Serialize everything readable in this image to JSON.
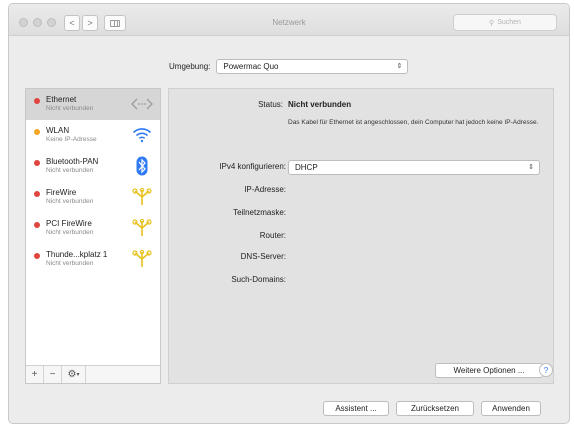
{
  "window": {
    "title": "Netzwerk",
    "search_placeholder": "Suchen",
    "nav_back": "<",
    "nav_forward": ">",
    "grid_icon": "show-all-grid-icon"
  },
  "location": {
    "label": "Umgebung:",
    "value": "Powermac Quo"
  },
  "services": [
    {
      "name": "Ethernet",
      "status": "Nicht verbunden",
      "dot_color": "#e0443e",
      "icon": "ethernet-icon"
    },
    {
      "name": "WLAN",
      "status": "Keine IP-Adresse",
      "dot_color": "#f5a623",
      "icon": "wifi-icon"
    },
    {
      "name": "Bluetooth-PAN",
      "status": "Nicht verbunden",
      "dot_color": "#e0443e",
      "icon": "bluetooth-icon"
    },
    {
      "name": "FireWire",
      "status": "Nicht verbunden",
      "dot_color": "#e0443e",
      "icon": "firewire-icon"
    },
    {
      "name": "PCI FireWire",
      "status": "Nicht verbunden",
      "dot_color": "#e0443e",
      "icon": "firewire-icon"
    },
    {
      "name": "Thunde...kplatz 1",
      "status": "Nicht verbunden",
      "dot_color": "#e0443e",
      "icon": "thunderbolt-bridge-icon"
    }
  ],
  "sidebar_controls": {
    "add": "+",
    "remove": "−"
  },
  "detail": {
    "status_label": "Status:",
    "status_value": "Nicht verbunden",
    "status_description": "Das Kabel für Ethernet ist angeschlossen, dein Computer hat jedoch keine IP-Adresse.",
    "ipv4_label": "IPv4 konfigurieren:",
    "ipv4_value": "DHCP",
    "ip_label": "IP-Adresse:",
    "subnet_label": "Teilnetzmaske:",
    "router_label": "Router:",
    "dns_label": "DNS-Server:",
    "search_domains_label": "Such-Domains:",
    "more_options": "Weitere Optionen ..."
  },
  "footer": {
    "assistant": "Assistent ...",
    "revert": "Zurücksetzen",
    "apply": "Anwenden"
  },
  "colors": {
    "accent_blue": "#2f7bf6",
    "firewire_yellow": "#e8c21e",
    "status_red": "#e0443e",
    "status_orange": "#f5a623"
  }
}
